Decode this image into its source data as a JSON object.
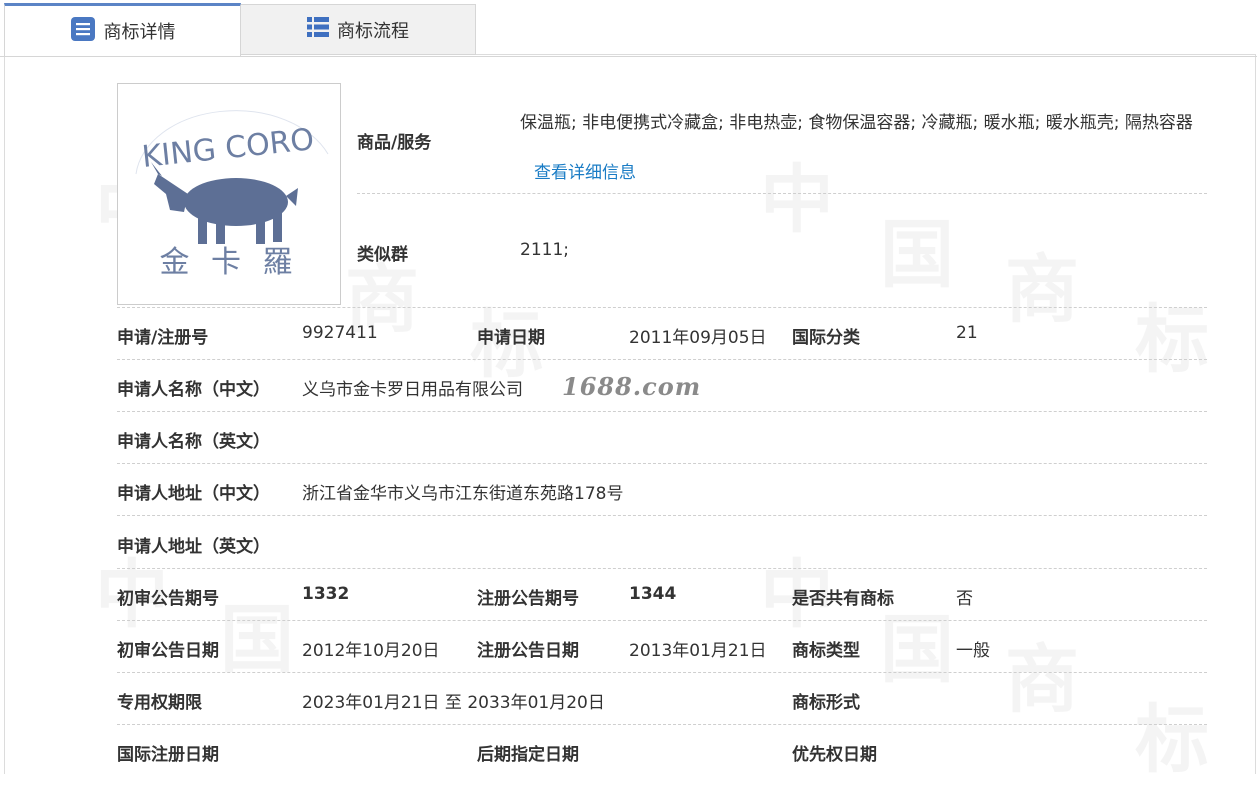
{
  "tabs": [
    {
      "label": "商标详情",
      "icon": "document-list-icon"
    },
    {
      "label": "商标流程",
      "icon": "table-grid-icon"
    }
  ],
  "logo": {
    "text_top": "KING CORO",
    "text_bottom": "金 卡 羅"
  },
  "goods": {
    "label": "商品/服务",
    "value": "保温瓶; 非电便携式冷藏盒; 非电热壶; 食物保温容器; 冷藏瓶; 暖水瓶; 暖水瓶壳; 隔热容器",
    "link": "查看详细信息"
  },
  "similar_group": {
    "label": "类似群",
    "value": "2111;"
  },
  "reg_no": {
    "label": "申请/注册号",
    "value": "9927411"
  },
  "apply_date": {
    "label": "申请日期",
    "value": "2011年09月05日"
  },
  "intl_class": {
    "label": "国际分类",
    "value": "21"
  },
  "applicant_cn": {
    "label": "申请人名称（中文）",
    "value": "义乌市金卡罗日用品有限公司"
  },
  "applicant_en": {
    "label": "申请人名称（英文）",
    "value": ""
  },
  "address_cn": {
    "label": "申请人地址（中文）",
    "value": "浙江省金华市义乌市江东街道东苑路178号"
  },
  "address_en": {
    "label": "申请人地址（英文）",
    "value": ""
  },
  "prelim_no": {
    "label": "初审公告期号",
    "value": "1332"
  },
  "reg_ann_no": {
    "label": "注册公告期号",
    "value": "1344"
  },
  "shared": {
    "label": "是否共有商标",
    "value": "否"
  },
  "prelim_date": {
    "label": "初审公告日期",
    "value": "2012年10月20日"
  },
  "reg_ann_date": {
    "label": "注册公告日期",
    "value": "2013年01月21日"
  },
  "tm_type": {
    "label": "商标类型",
    "value": "一般"
  },
  "exclusive_period": {
    "label": "专用权期限",
    "value": "2023年01月21日 至 2033年01月20日"
  },
  "tm_form": {
    "label": "商标形式",
    "value": ""
  },
  "intl_reg_date": {
    "label": "国际注册日期",
    "value": ""
  },
  "later_date": {
    "label": "后期指定日期",
    "value": ""
  },
  "priority_date": {
    "label": "优先权日期",
    "value": ""
  },
  "site_watermark": "1688.com",
  "watermark_chars": [
    "中",
    "国",
    "商",
    "标"
  ]
}
